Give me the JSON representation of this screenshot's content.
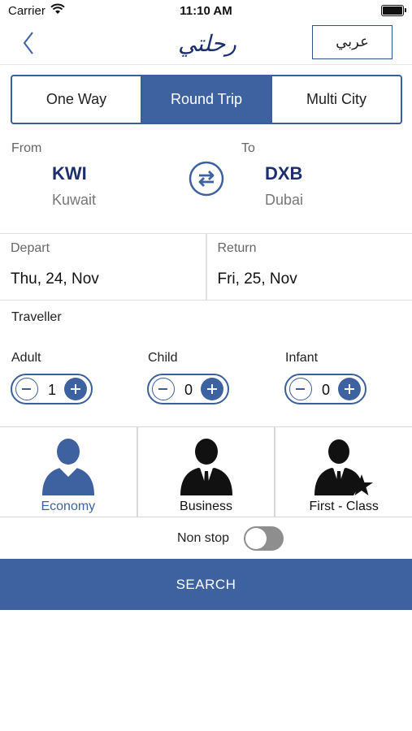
{
  "status_bar": {
    "carrier": "Carrier",
    "time": "11:10 AM"
  },
  "nav": {
    "lang_button": "عربي",
    "logo_text": "رحلتي"
  },
  "trip_types": [
    {
      "label": "One Way",
      "active": false
    },
    {
      "label": "Round Trip",
      "active": true
    },
    {
      "label": "Multi City",
      "active": false
    }
  ],
  "route": {
    "from_label": "From",
    "from_code": "KWI",
    "from_city": "Kuwait",
    "to_label": "To",
    "to_code": "DXB",
    "to_city": "Dubai"
  },
  "dates": {
    "depart_label": "Depart",
    "depart_value": "Thu, 24, Nov",
    "return_label": "Return",
    "return_value": "Fri, 25, Nov"
  },
  "traveller": {
    "title": "Traveller",
    "adult_label": "Adult",
    "adult_count": "1",
    "child_label": "Child",
    "child_count": "0",
    "infant_label": "Infant",
    "infant_count": "0"
  },
  "cabins": [
    {
      "label": "Economy",
      "active": true
    },
    {
      "label": "Business",
      "active": false
    },
    {
      "label": "First - Class",
      "active": false
    }
  ],
  "non_stop": {
    "label": "Non stop",
    "enabled": false
  },
  "search_button": "SEARCH",
  "colors": {
    "accent": "#3e62a0",
    "code_text": "#1d2f6f",
    "border": "#3b5f9a"
  }
}
